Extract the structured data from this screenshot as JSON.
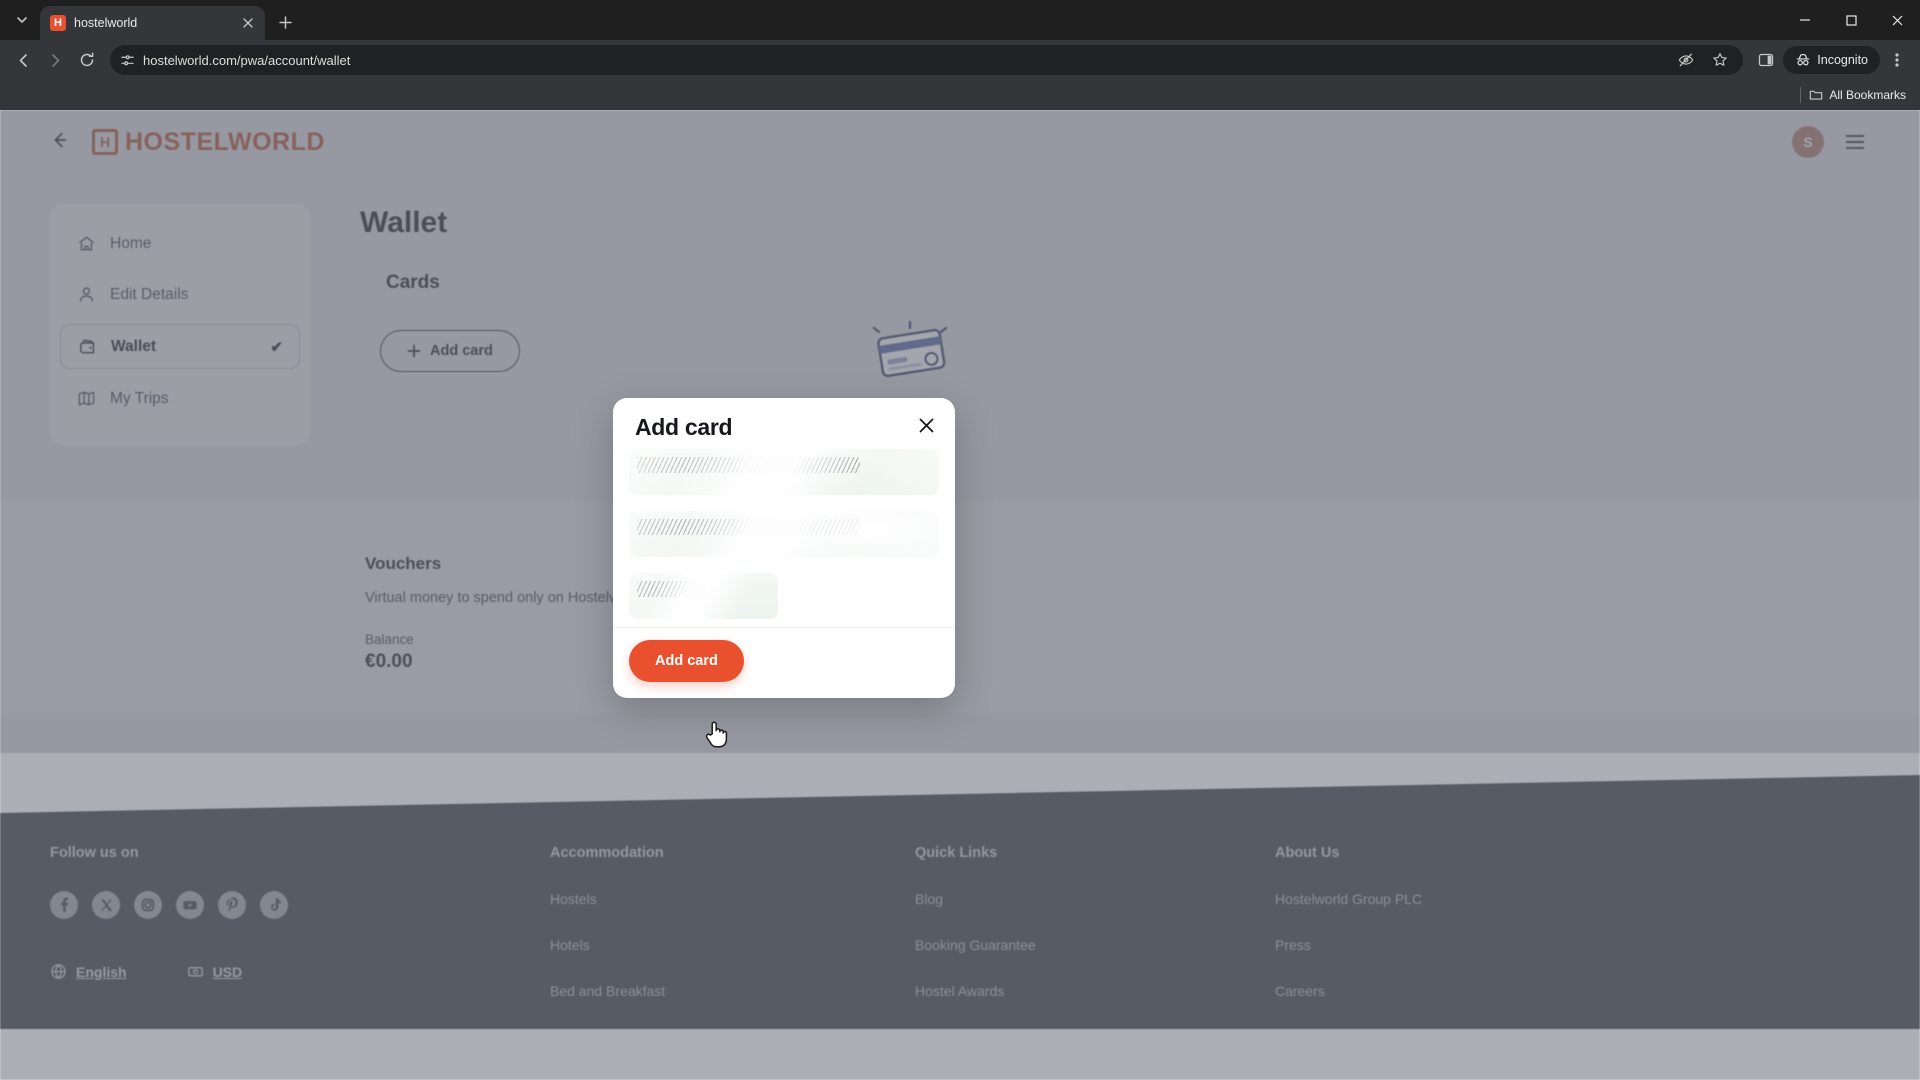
{
  "browser": {
    "tab": {
      "title": "hostelworld",
      "favicon_letter": "H",
      "close_icon": "close-icon"
    },
    "new_tab_icon": "plus-icon",
    "tab_search_icon": "chevron-down-icon",
    "nav": {
      "back_icon": "back-arrow-icon",
      "forward_icon": "forward-arrow-icon",
      "reload_icon": "reload-icon"
    },
    "omnibox": {
      "site_settings_icon": "site-settings-icon",
      "url": "hostelworld.com/pwa/account/wallet"
    },
    "omni_actions": {
      "tracking_icon": "eye-off-icon",
      "bookmark_icon": "star-icon",
      "split_icon": "side-panel-icon"
    },
    "incognito": {
      "label": "Incognito",
      "icon": "incognito-icon"
    },
    "menu_icon": "three-dot-menu-icon",
    "bookmarks": {
      "label": "All Bookmarks",
      "icon": "folder-icon"
    },
    "window": {
      "minimize": "—",
      "maximize": "☐",
      "close": "✕"
    }
  },
  "header": {
    "back_label": "←",
    "logo_text": "HOSTELWORLD",
    "logo_mark": "H",
    "avatar_initial": "S",
    "menu_icon": "hamburger-menu-icon"
  },
  "sidebar": {
    "items": [
      {
        "label": "Home",
        "icon": "home-icon",
        "active": false
      },
      {
        "label": "Edit Details",
        "icon": "user-icon",
        "active": false
      },
      {
        "label": "Wallet",
        "icon": "wallet-icon",
        "active": true,
        "check": "✔"
      },
      {
        "label": "My Trips",
        "icon": "map-icon",
        "active": false
      }
    ]
  },
  "main": {
    "page_title": "Wallet",
    "cards_section": {
      "heading": "Cards",
      "add_card_label": "Add card",
      "add_icon": "plus-icon",
      "illustration": "credit-card-illustration"
    },
    "vouchers": {
      "title": "Vouchers",
      "description": "Virtual money to spend only on Hostelworld",
      "balance_label": "Balance",
      "balance_value": "€0.00"
    }
  },
  "modal": {
    "title": "Add card",
    "close_icon": "close-icon",
    "state": "loading-skeleton",
    "submit_label": "Add card",
    "submit_color": "#e8502e"
  },
  "footer": {
    "social": {
      "heading": "Follow us on",
      "icons": [
        "facebook-icon",
        "x-twitter-icon",
        "instagram-icon",
        "youtube-icon",
        "pinterest-icon",
        "tiktok-icon"
      ]
    },
    "prefs": [
      {
        "label": "English",
        "icon": "globe-icon"
      },
      {
        "label": "USD",
        "icon": "money-icon"
      }
    ],
    "columns": [
      {
        "heading": "Accommodation",
        "links": [
          "Hostels",
          "Hotels",
          "Bed and Breakfast"
        ]
      },
      {
        "heading": "Quick Links",
        "links": [
          "Blog",
          "Booking Guarantee",
          "Hostel Awards"
        ]
      },
      {
        "heading": "About Us",
        "links": [
          "Hostelworld Group PLC",
          "Press",
          "Careers"
        ]
      }
    ]
  },
  "cursor": {
    "type": "pointer-hand"
  },
  "colors": {
    "brand": "#e8502e",
    "page_bg": "#dfe1e5",
    "footer_bg": "#474d5a",
    "text_dark": "#2b3040"
  }
}
